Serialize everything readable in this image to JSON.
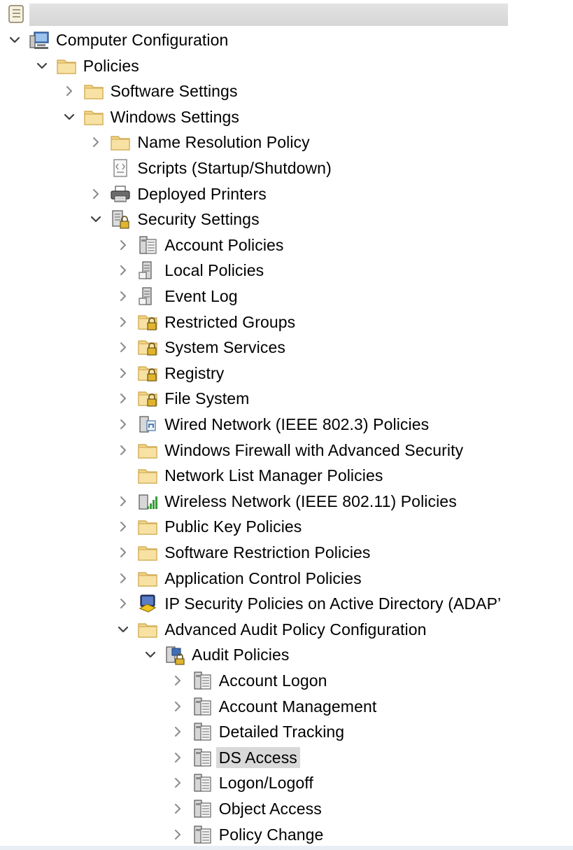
{
  "tree": [
    {
      "label": "Computer Configuration",
      "level": 0,
      "expander": "expanded",
      "icon": "computer-icon"
    },
    {
      "label": "Policies",
      "level": 1,
      "expander": "expanded",
      "icon": "folder-icon"
    },
    {
      "label": "Software Settings",
      "level": 2,
      "expander": "collapsed",
      "icon": "folder-icon"
    },
    {
      "label": "Windows Settings",
      "level": 2,
      "expander": "expanded",
      "icon": "folder-icon"
    },
    {
      "label": "Name Resolution Policy",
      "level": 3,
      "expander": "collapsed",
      "icon": "folder-icon"
    },
    {
      "label": "Scripts (Startup/Shutdown)",
      "level": 3,
      "expander": "none",
      "icon": "script-icon"
    },
    {
      "label": "Deployed Printers",
      "level": 3,
      "expander": "collapsed",
      "icon": "printer-icon"
    },
    {
      "label": "Security Settings",
      "level": 3,
      "expander": "expanded",
      "icon": "security-settings-icon"
    },
    {
      "label": "Account Policies",
      "level": 4,
      "expander": "collapsed",
      "icon": "policy-list-icon"
    },
    {
      "label": "Local Policies",
      "level": 4,
      "expander": "collapsed",
      "icon": "policy-server-icon"
    },
    {
      "label": "Event Log",
      "level": 4,
      "expander": "collapsed",
      "icon": "policy-server-icon"
    },
    {
      "label": "Restricted Groups",
      "level": 4,
      "expander": "collapsed",
      "icon": "locked-folder-icon"
    },
    {
      "label": "System Services",
      "level": 4,
      "expander": "collapsed",
      "icon": "locked-folder-icon"
    },
    {
      "label": "Registry",
      "level": 4,
      "expander": "collapsed",
      "icon": "locked-folder-icon"
    },
    {
      "label": "File System",
      "level": 4,
      "expander": "collapsed",
      "icon": "locked-folder-icon"
    },
    {
      "label": "Wired Network (IEEE 802.3) Policies",
      "level": 4,
      "expander": "collapsed",
      "icon": "wired-network-icon"
    },
    {
      "label": "Windows Firewall with Advanced Security",
      "level": 4,
      "expander": "collapsed",
      "icon": "folder-icon"
    },
    {
      "label": "Network List Manager Policies",
      "level": 4,
      "expander": "none",
      "icon": "folder-icon"
    },
    {
      "label": "Wireless Network (IEEE 802.11) Policies",
      "level": 4,
      "expander": "collapsed",
      "icon": "wireless-network-icon"
    },
    {
      "label": "Public Key Policies",
      "level": 4,
      "expander": "collapsed",
      "icon": "folder-icon"
    },
    {
      "label": "Software Restriction Policies",
      "level": 4,
      "expander": "collapsed",
      "icon": "folder-icon"
    },
    {
      "label": "Application Control Policies",
      "level": 4,
      "expander": "collapsed",
      "icon": "folder-icon"
    },
    {
      "label": "IP Security Policies on Active Directory (ADAP’",
      "level": 4,
      "expander": "collapsed",
      "icon": "ip-security-icon"
    },
    {
      "label": "Advanced Audit Policy Configuration",
      "level": 4,
      "expander": "expanded",
      "icon": "folder-icon"
    },
    {
      "label": "Audit Policies",
      "level": 5,
      "expander": "expanded",
      "icon": "audit-policies-icon"
    },
    {
      "label": "Account Logon",
      "level": 6,
      "expander": "collapsed",
      "icon": "policy-list-icon"
    },
    {
      "label": "Account Management",
      "level": 6,
      "expander": "collapsed",
      "icon": "policy-list-icon"
    },
    {
      "label": "Detailed Tracking",
      "level": 6,
      "expander": "collapsed",
      "icon": "policy-list-icon"
    },
    {
      "label": "DS Access",
      "level": 6,
      "expander": "collapsed",
      "icon": "policy-list-icon",
      "selected": true
    },
    {
      "label": "Logon/Logoff",
      "level": 6,
      "expander": "collapsed",
      "icon": "policy-list-icon"
    },
    {
      "label": "Object Access",
      "level": 6,
      "expander": "collapsed",
      "icon": "policy-list-icon"
    },
    {
      "label": "Policy Change",
      "level": 6,
      "expander": "collapsed",
      "icon": "policy-list-icon"
    }
  ],
  "colors": {
    "selection": "#d9d9d9",
    "folder": "#f3d588",
    "folder_edge": "#d9b45a",
    "chevron": "#5a5a5a"
  }
}
